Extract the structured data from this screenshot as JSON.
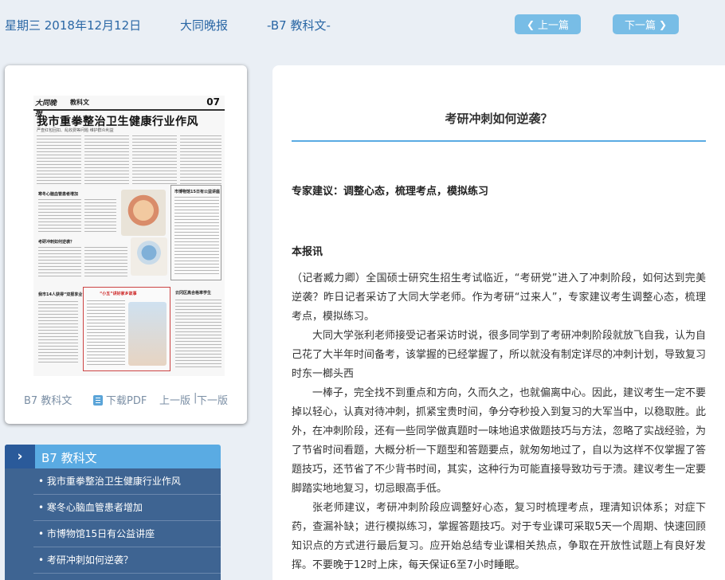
{
  "header": {
    "date": "星期三 2018年12月12日",
    "paper": "大同晚报",
    "section": "-B7 教科文-",
    "prev_label": "上一篇",
    "next_label": "下一篇"
  },
  "thumbnail": {
    "logo": "大同晚报",
    "section": "教科文",
    "page_no": "07",
    "headline": "我市重拳整治卫生健康行业作风",
    "subhead": "严查红包回扣、乱收费等问题 维护群众利益",
    "item2": "寒冬心脑血管患者增加",
    "item3": "考研冲刺如何逆袭？",
    "item4": "市博物馆15日有公益讲座",
    "item5": "我市14人获得“双报享业”证书",
    "item6": "云冈区高合格率学生",
    "item7": "“小五”讲好家乡故事"
  },
  "card_footer": {
    "page": "B7 教科文",
    "download": "下载PDF",
    "prev": "上一版",
    "sep": "|",
    "next": "下一版"
  },
  "article_list": {
    "title": "B7 教科文",
    "items": [
      "• 我市重拳整治卫生健康行业作风",
      "• 寒冬心脑血管患者增加",
      "• 市博物馆15日有公益讲座",
      "• 考研冲刺如何逆袭？"
    ]
  },
  "article": {
    "title": "考研冲刺如何逆袭？",
    "subtitle": "专家建议：调整心态，梳理考点，模拟练习",
    "byline": "本报讯",
    "paragraphs": [
      "（记者臧力卿）全国硕士研究生招生考试临近，“考研党”进入了冲刺阶段，如何达到完美逆袭？昨日记者采访了大同大学老师。作为考研“过来人”，专家建议考生调整心态，梳理考点，模拟练习。",
      "大同大学张利老师接受记者采访时说，很多同学到了考研冲刺阶段就放飞自我，认为自己花了大半年时间备考，该掌握的已经掌握了，所以就没有制定详尽的冲刺计划，导致复习时东一榔头西",
      "一棒子，完全找不到重点和方向，久而久之，也就偏离中心。因此，建议考生一定不要掉以轻心，认真对待冲刺，抓紧宝贵时间，争分夺秒投入到复习的大军当中，以稳取胜。此外，在冲刺阶段，还有一些同学做真题时一味地追求做题技巧与方法，忽略了实战经验，为了节省时间看题，大概分析一下题型和答题要点，就匆匆地过了，自以为这样不仅掌握了答题技巧，还节省了不少背书时间，其实，这种行为可能直接导致功亏于溃。建议考生一定要脚踏实地地复习，切忌眼高手低。",
      "张老师建议，考研冲刺阶段应调整好心态，复习时梳理考点，理清知识体系；对症下药，查漏补缺；进行模拟练习，掌握答题技巧。对于专业课可采取5天一个周期、快速回顾知识点的方式进行最后复习。应开始总结专业课相关热点，争取在开放性试题上有良好发挥。不要晚于12时上床，每天保证6至7小时睡眠。"
    ]
  }
}
